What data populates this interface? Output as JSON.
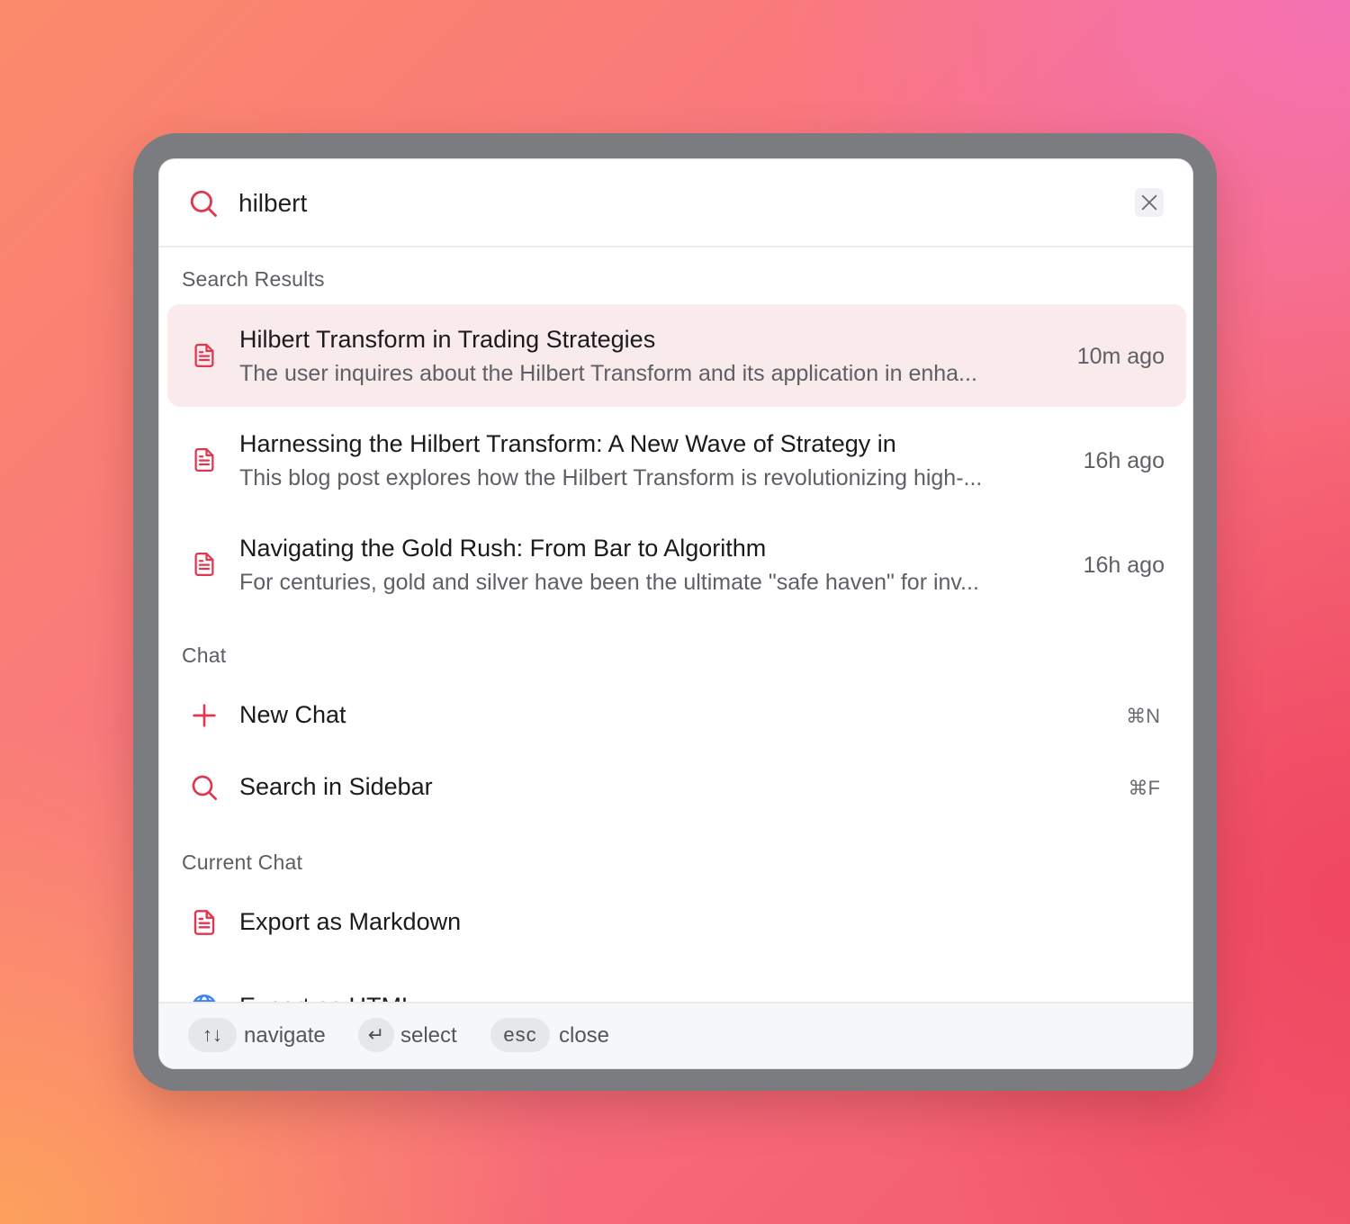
{
  "search": {
    "query": "hilbert",
    "icon": "search-icon",
    "close_icon": "close-icon"
  },
  "sections": {
    "results_label": "Search Results",
    "chat_label": "Chat",
    "current_chat_label": "Current Chat"
  },
  "results": [
    {
      "title": "Hilbert Transform in Trading Strategies",
      "snippet": "The user inquires about the Hilbert Transform and its application in enha...",
      "time": "10m ago",
      "icon": "document-icon"
    },
    {
      "title": "Harnessing the Hilbert Transform: A New Wave of Strategy in",
      "snippet": "This blog post explores how the Hilbert Transform is revolutionizing high-...",
      "time": "16h ago",
      "icon": "document-icon"
    },
    {
      "title": "Navigating the Gold Rush: From Bar to Algorithm",
      "snippet": "For centuries, gold and silver have been the ultimate \"safe haven\" for inv...",
      "time": "16h ago",
      "icon": "document-icon"
    }
  ],
  "chat_commands": [
    {
      "label": "New Chat",
      "shortcut": "⌘N",
      "icon": "plus-icon"
    },
    {
      "label": "Search in Sidebar",
      "shortcut": "⌘F",
      "icon": "search-icon"
    }
  ],
  "current_chat_commands": [
    {
      "label": "Export as Markdown",
      "icon": "document-icon"
    },
    {
      "label": "Export as HTML",
      "icon": "globe-icon"
    }
  ],
  "footer": {
    "navigate_key": "↑↓",
    "navigate_label": "navigate",
    "select_key": "↵",
    "select_label": "select",
    "close_key": "esc",
    "close_label": "close"
  },
  "colors": {
    "accent": "#e0364f",
    "active_row": "#f9ebeb",
    "globe": "#3b82f6"
  }
}
